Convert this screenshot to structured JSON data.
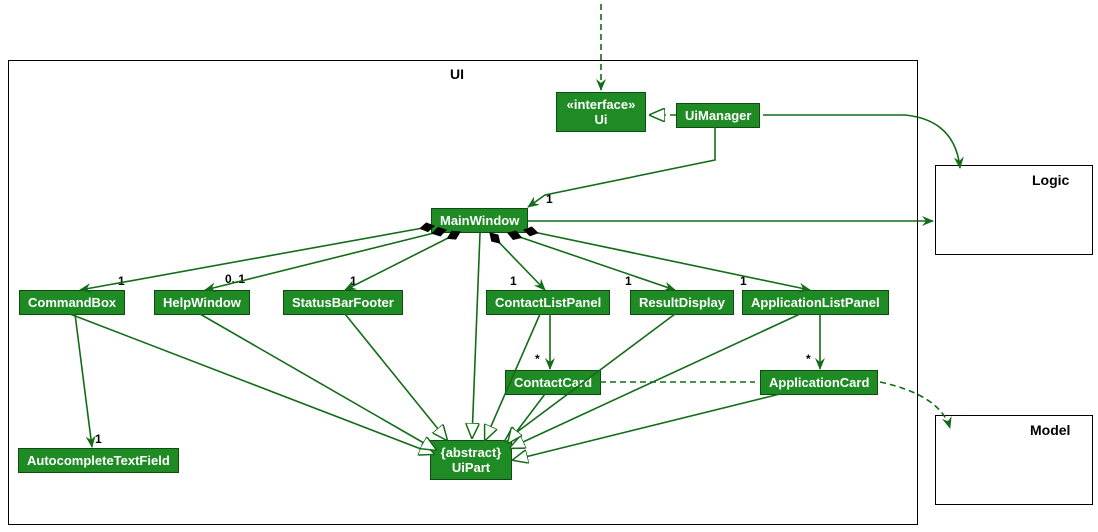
{
  "packages": {
    "ui": "UI",
    "logic": "Logic",
    "model": "Model"
  },
  "nodes": {
    "ui_interface": {
      "stereotype": "«interface»",
      "name": "Ui"
    },
    "ui_manager": "UiManager",
    "main_window": "MainWindow",
    "command_box": "CommandBox",
    "help_window": "HelpWindow",
    "status_bar_footer": "StatusBarFooter",
    "contact_list_panel": "ContactListPanel",
    "result_display": "ResultDisplay",
    "application_list_panel": "ApplicationListPanel",
    "contact_card": "ContactCard",
    "application_card": "ApplicationCard",
    "autocomplete_text_field": "AutocompleteTextField",
    "ui_part": {
      "stereotype": "{abstract}",
      "name": "UiPart"
    }
  },
  "multiplicities": {
    "mw_from_um": "1",
    "cmdbox": "1",
    "helpwin": "0..1",
    "statusbar": "1",
    "clp": "1",
    "resultdisp": "1",
    "alp": "1",
    "contactcard": "*",
    "appcard": "*",
    "autotf": "1"
  },
  "colors": {
    "node_fill": "#1f8b24",
    "edge": "#136c17"
  }
}
